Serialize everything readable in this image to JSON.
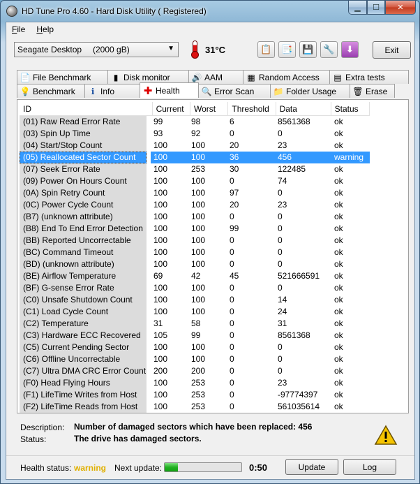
{
  "window": {
    "title": "HD Tune Pro 4.60 - Hard Disk Utility (  Registered)"
  },
  "menu": [
    {
      "label": "File",
      "hotkey": "F",
      "rest": "ile"
    },
    {
      "label": "Help",
      "hotkey": "H",
      "rest": "elp"
    }
  ],
  "toolbar": {
    "drive_name": "Seagate Desktop",
    "drive_capacity": "(2000 gB)",
    "temperature": "31°C",
    "exit_label": "Exit"
  },
  "tabs_top": [
    {
      "label": "File Benchmark",
      "icon": "file-benchmark-icon",
      "glyph": "📄"
    },
    {
      "label": "Disk monitor",
      "icon": "disk-monitor-icon",
      "glyph": "▮"
    },
    {
      "label": "AAM",
      "icon": "speaker-icon",
      "glyph": "🔊"
    },
    {
      "label": "Random Access",
      "icon": "random-access-icon",
      "glyph": "▦"
    },
    {
      "label": "Extra tests",
      "icon": "extra-tests-icon",
      "glyph": "▤"
    }
  ],
  "tabs_bottom": [
    {
      "label": "Benchmark",
      "icon": "lightbulb-icon",
      "glyph": "💡"
    },
    {
      "label": "Info",
      "icon": "info-icon",
      "glyph": "ℹ"
    },
    {
      "label": "Health",
      "icon": "red-cross-icon",
      "glyph": "✚",
      "active": true
    },
    {
      "label": "Error Scan",
      "icon": "magnifier-icon",
      "glyph": "🔍"
    },
    {
      "label": "Folder Usage",
      "icon": "folder-icon",
      "glyph": "📁"
    },
    {
      "label": "Erase",
      "icon": "trash-icon",
      "glyph": "🗑"
    }
  ],
  "table": {
    "headers": [
      "ID",
      "Current",
      "Worst",
      "Threshold",
      "Data",
      "Status"
    ],
    "rows": [
      [
        "(01) Raw Read Error Rate",
        "99",
        "98",
        "6",
        "8561368",
        "ok"
      ],
      [
        "(03) Spin Up Time",
        "93",
        "92",
        "0",
        "0",
        "ok"
      ],
      [
        "(04) Start/Stop Count",
        "100",
        "100",
        "20",
        "23",
        "ok"
      ],
      [
        "(05) Reallocated Sector Count",
        "100",
        "100",
        "36",
        "456",
        "warning"
      ],
      [
        "(07) Seek Error Rate",
        "100",
        "253",
        "30",
        "122485",
        "ok"
      ],
      [
        "(09) Power On Hours Count",
        "100",
        "100",
        "0",
        "74",
        "ok"
      ],
      [
        "(0A) Spin Retry Count",
        "100",
        "100",
        "97",
        "0",
        "ok"
      ],
      [
        "(0C) Power Cycle Count",
        "100",
        "100",
        "20",
        "23",
        "ok"
      ],
      [
        "(B7) (unknown attribute)",
        "100",
        "100",
        "0",
        "0",
        "ok"
      ],
      [
        "(B8) End To End Error Detection",
        "100",
        "100",
        "99",
        "0",
        "ok"
      ],
      [
        "(BB) Reported Uncorrectable Errors",
        "100",
        "100",
        "0",
        "0",
        "ok"
      ],
      [
        "(BC) Command Timeout",
        "100",
        "100",
        "0",
        "0",
        "ok"
      ],
      [
        "(BD) (unknown attribute)",
        "100",
        "100",
        "0",
        "0",
        "ok"
      ],
      [
        "(BE) Airflow Temperature",
        "69",
        "42",
        "45",
        "521666591",
        "ok"
      ],
      [
        "(BF) G-sense Error Rate",
        "100",
        "100",
        "0",
        "0",
        "ok"
      ],
      [
        "(C0) Unsafe Shutdown Count",
        "100",
        "100",
        "0",
        "14",
        "ok"
      ],
      [
        "(C1) Load Cycle Count",
        "100",
        "100",
        "0",
        "24",
        "ok"
      ],
      [
        "(C2) Temperature",
        "31",
        "58",
        "0",
        "31",
        "ok"
      ],
      [
        "(C3) Hardware ECC Recovered",
        "105",
        "99",
        "0",
        "8561368",
        "ok"
      ],
      [
        "(C5) Current Pending Sector",
        "100",
        "100",
        "0",
        "0",
        "ok"
      ],
      [
        "(C6) Offline Uncorrectable",
        "100",
        "100",
        "0",
        "0",
        "ok"
      ],
      [
        "(C7) Ultra DMA CRC Error Count",
        "200",
        "200",
        "0",
        "0",
        "ok"
      ],
      [
        "(F0) Head Flying Hours",
        "100",
        "253",
        "0",
        "23",
        "ok"
      ],
      [
        "(F1) LifeTime Writes from Host",
        "100",
        "253",
        "0",
        "-97774397",
        "ok"
      ],
      [
        "(F2) LifeTime Reads from Host",
        "100",
        "253",
        "0",
        "561035614",
        "ok"
      ]
    ],
    "selected_index": 3
  },
  "info": {
    "description_label": "Description:",
    "description": "Number of damaged sectors which have been replaced: 456",
    "status_label": "Status:",
    "status": "The drive has damaged sectors."
  },
  "footer": {
    "health_label": "Health status:",
    "health_value": "warning",
    "health_color": "#e0b000",
    "next_update_label": "Next update:",
    "progress_fraction": 0.17,
    "countdown": "0:50",
    "update_label": "Update",
    "log_label": "Log"
  }
}
